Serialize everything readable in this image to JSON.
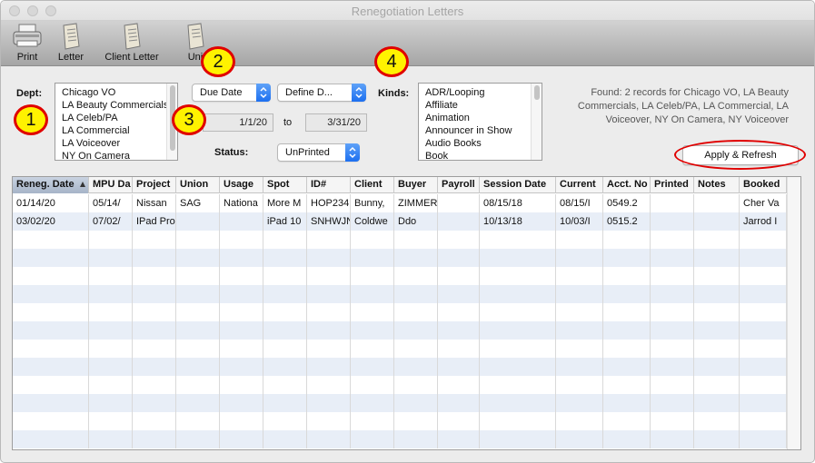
{
  "window": {
    "title": "Renegotiation Letters"
  },
  "toolbar": {
    "items": [
      {
        "label": "Print",
        "icon": "printer-icon"
      },
      {
        "label": "Letter",
        "icon": "document-icon"
      },
      {
        "label": "Client Letter",
        "icon": "document-icon"
      },
      {
        "label": "Uni",
        "icon": "document-icon"
      }
    ]
  },
  "dept": {
    "label": "Dept:",
    "items": [
      "Chicago VO",
      "LA Beauty Commercials",
      "LA Celeb/PA",
      "LA Commercial",
      "LA Voiceover",
      "NY On Camera"
    ]
  },
  "date_filter": {
    "field": "Due Date",
    "range": "Define D...",
    "from": "1/1/20",
    "to_label": "to",
    "to": "3/31/20"
  },
  "status": {
    "label": "Status:",
    "value": "UnPrinted"
  },
  "kinds": {
    "label": "Kinds:",
    "items": [
      "ADR/Looping",
      "Affiliate",
      "Animation",
      "Announcer in Show",
      "Audio Books",
      "Book"
    ]
  },
  "found_text": "Found: 2 records for Chicago VO, LA Beauty Commercials, LA Celeb/PA, LA Commercial, LA Voiceover, NY On Camera, NY Voiceover",
  "apply_button": "Apply & Refresh",
  "annotations": [
    "1",
    "2",
    "3",
    "4"
  ],
  "table": {
    "columns": [
      "Reneg. Date",
      "MPU Da",
      "Project",
      "Union",
      "Usage",
      "Spot",
      "ID#",
      "Client",
      "Buyer",
      "Payroll",
      "Session Date",
      "Current",
      "Acct. No",
      "Printed",
      "Notes",
      "Booked"
    ],
    "rows": [
      [
        "01/14/20",
        "05/14/",
        "Nissan",
        "SAG",
        "Nationa",
        "More M",
        "HOP234",
        "Bunny,",
        "ZIMMER",
        "",
        "08/15/18",
        "08/15/I",
        "0549.2",
        "",
        "",
        "Cher Va"
      ],
      [
        "03/02/20",
        "07/02/",
        "IPad Pro",
        "",
        "",
        "iPad 10",
        "SNHWJN",
        "Coldwe",
        "Ddo",
        "",
        "10/13/18",
        "10/03/I",
        "0515.2",
        "",
        "",
        "Jarrod I"
      ]
    ]
  },
  "colors": {
    "accent": "#1c6ff0",
    "annotation_ring": "#e00000",
    "annotation_fill": "#fff200"
  }
}
